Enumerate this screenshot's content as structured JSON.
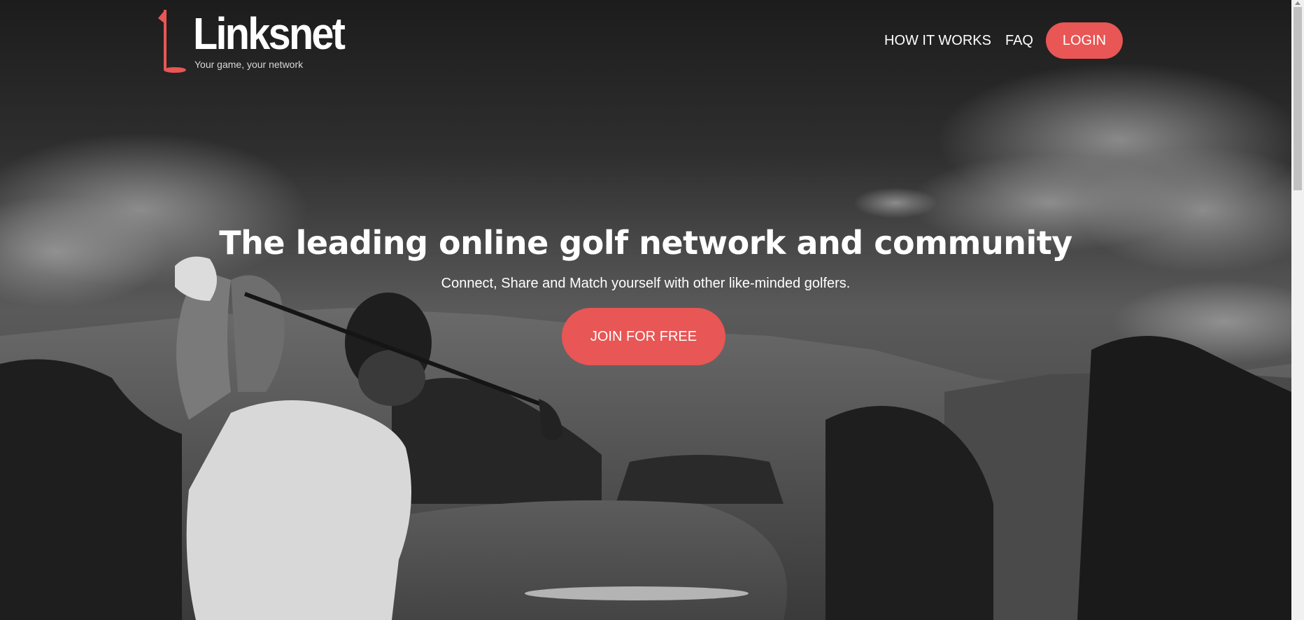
{
  "brand": {
    "name": "Linksnet",
    "tagline": "Your game, your network",
    "icon": "golf-flag-icon"
  },
  "nav": {
    "links": [
      "HOW IT WORKS",
      "FAQ"
    ],
    "login_label": "LOGIN"
  },
  "hero": {
    "headline": "The leading online golf network and community",
    "subheadline": "Connect, Share and Match yourself with other like-minded golfers.",
    "cta_label": "JOIN FOR FREE",
    "background_image": "golfer-swing-photo"
  },
  "colors": {
    "accent": "#e85655",
    "text": "#ffffff"
  }
}
